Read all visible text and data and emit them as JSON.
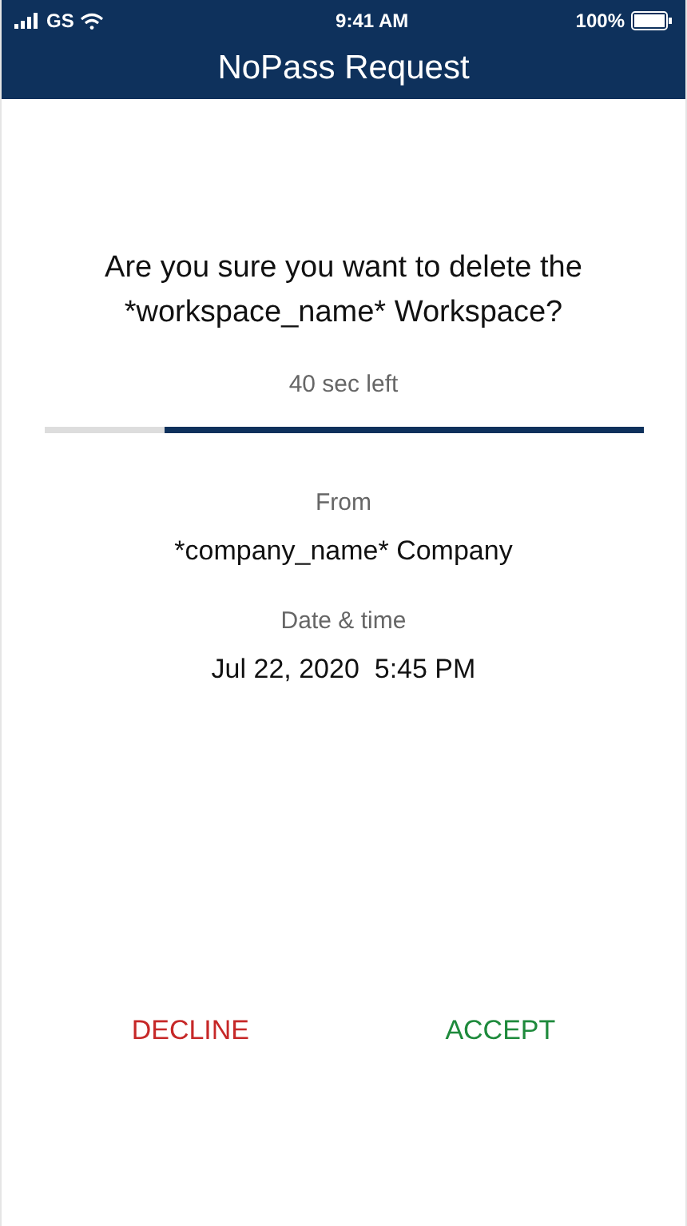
{
  "status_bar": {
    "carrier": "GS",
    "time": "9:41 AM",
    "battery": "100%"
  },
  "header": {
    "title": "NoPass Request"
  },
  "question": "Are you sure you want to delete the *workspace_name* Workspace?",
  "timer": {
    "text": "40 sec left",
    "level": 0.8
  },
  "details": [
    {
      "label": "From",
      "value": "*company_name* Company"
    },
    {
      "label": "Date & time",
      "value": "Jul 22, 2020  5:45 PM"
    }
  ],
  "actions": [
    {
      "label": "DECLINE",
      "kind": "decline"
    },
    {
      "label": "ACCEPT",
      "kind": "accept"
    }
  ]
}
